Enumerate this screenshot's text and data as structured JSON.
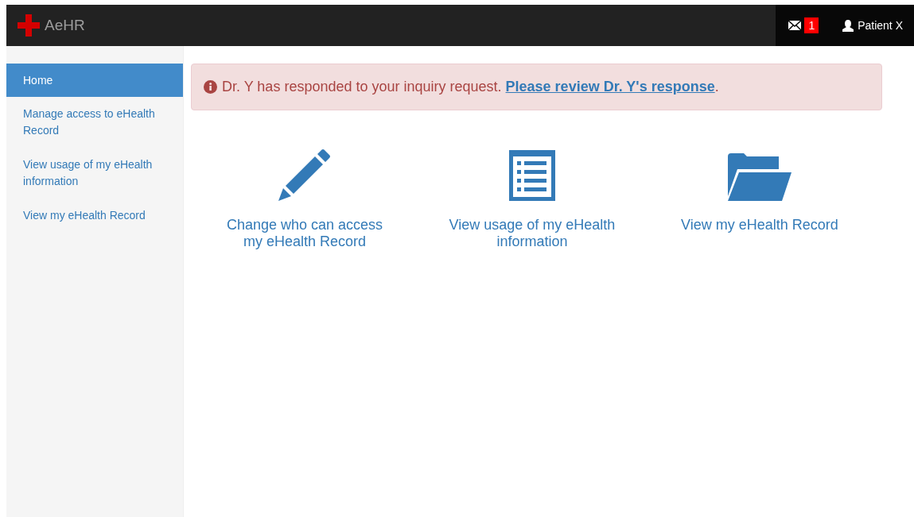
{
  "navbar": {
    "brand": "AeHR",
    "message_count": "1",
    "user": "Patient X"
  },
  "sidebar": {
    "items": [
      {
        "label": "Home",
        "selected": true
      },
      {
        "label": "Manage access to eHealth Record",
        "selected": false
      },
      {
        "label": "View usage of my eHealth information",
        "selected": false
      },
      {
        "label": "View my eHealth Record",
        "selected": false
      }
    ]
  },
  "alert": {
    "message": "Dr. Y has responded to your inquiry request.",
    "link": "Please review Dr. Y's response",
    "suffix": "."
  },
  "tiles": [
    {
      "kind": "pencil",
      "label": "Change who can access my eHealth Record"
    },
    {
      "kind": "list",
      "label": "View usage of my eHealth information"
    },
    {
      "kind": "folder",
      "label": "View my eHealth Record"
    }
  ]
}
